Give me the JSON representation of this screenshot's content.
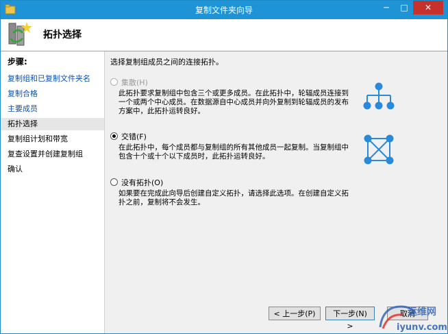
{
  "window": {
    "title": "复制文件夹向导"
  },
  "window_buttons": {
    "minimize": "─",
    "maximize": "□",
    "close": "✕"
  },
  "header": {
    "title": "拓扑选择"
  },
  "sidebar": {
    "title": "步骤:",
    "items": [
      {
        "label": "复制组和已复制文件夹名",
        "state": "link"
      },
      {
        "label": "复制合格",
        "state": "link"
      },
      {
        "label": "主要成员",
        "state": "link"
      },
      {
        "label": "拓扑选择",
        "state": "current"
      },
      {
        "label": "复制组计划和带宽",
        "state": "plain"
      },
      {
        "label": "复查设置并创建复制组",
        "state": "plain"
      },
      {
        "label": "确认",
        "state": "plain"
      }
    ]
  },
  "main": {
    "intro": "选择复制组成员之间的连接拓扑。",
    "options": [
      {
        "label": "集散(H)",
        "selected": false,
        "disabled": true,
        "desc": "此拓扑要求复制组中包含三个或更多成员。在此拓扑中，轮辐成员连接到一个或两个中心成员。在数据源自中心成员并向外复制到轮辐成员的发布方案中，此拓扑运转良好。"
      },
      {
        "label": "交错(F)",
        "selected": true,
        "disabled": false,
        "desc": "在此拓扑中，每个成员都与复制组的所有其他成员一起复制。当复制组中包含十个或十个以下成员时，此拓扑运转良好。"
      },
      {
        "label": "没有拓扑(O)",
        "selected": false,
        "disabled": false,
        "desc": "如果要在完成此向导后创建自定义拓扑，请选择此选项。在创建自定义拓扑之前，复制将不会发生。"
      }
    ]
  },
  "footer": {
    "back": "< 上一步(P)",
    "next": "下一步(N) >",
    "cancel": "取消"
  },
  "watermark": {
    "text1": "运维网",
    "text2": "iyunv.com"
  },
  "colors": {
    "titlebar": "#1e93d6",
    "link": "#0a52b0",
    "diagram": "#2b8ad8"
  }
}
